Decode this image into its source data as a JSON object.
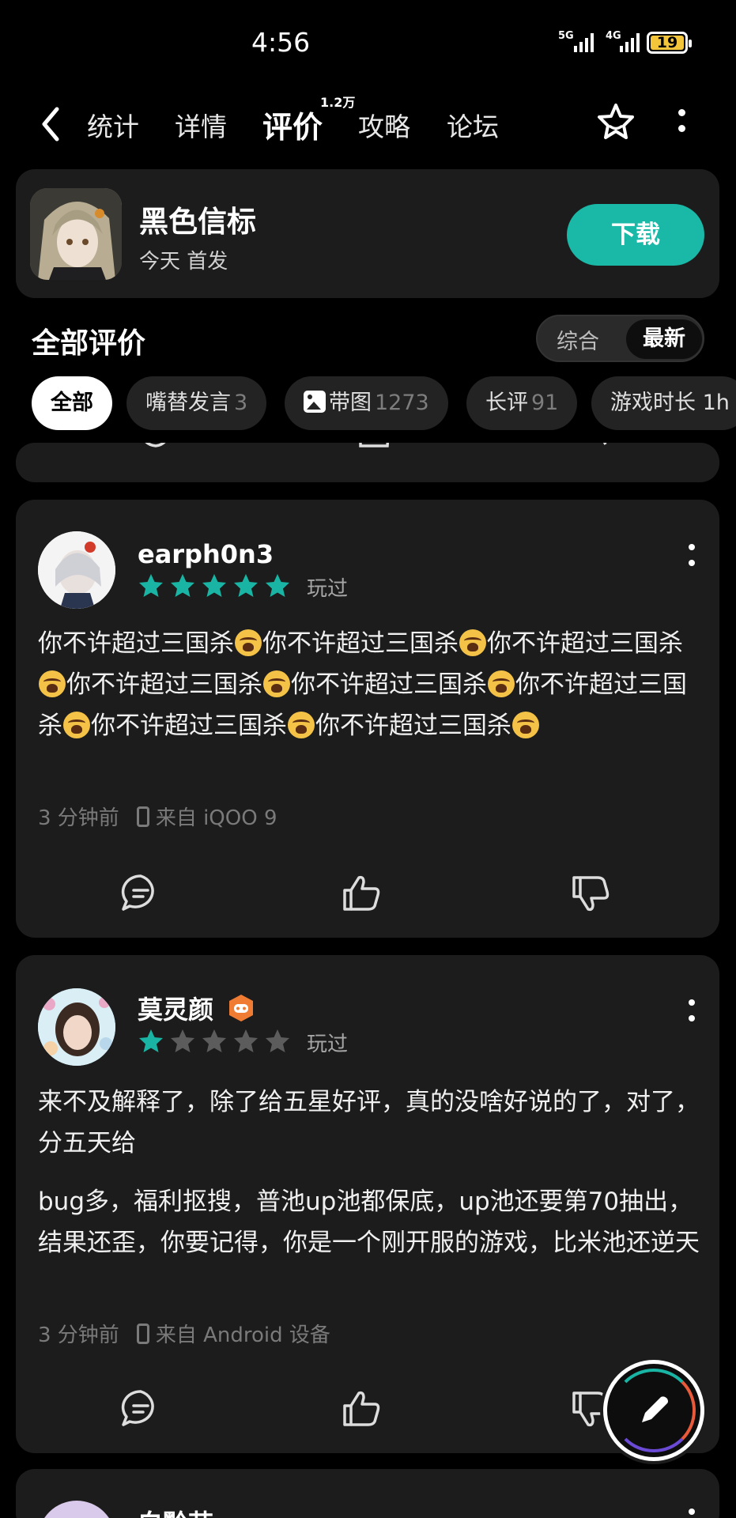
{
  "status_bar": {
    "time": "4:56",
    "signal1": "5G",
    "signal2": "4G",
    "battery": "19"
  },
  "nav": {
    "tabs": [
      {
        "label": "统计"
      },
      {
        "label": "详情"
      },
      {
        "label": "评价",
        "count": "1.2万",
        "active": true
      },
      {
        "label": "攻略"
      },
      {
        "label": "论坛"
      }
    ]
  },
  "game": {
    "title": "黑色信标",
    "subtitle": "今天 首发",
    "download_label": "下载"
  },
  "reviews_header": {
    "title": "全部评价",
    "sort_options": [
      "综合",
      "最新"
    ],
    "sort_selected": "最新"
  },
  "filters": [
    {
      "label": "全部",
      "count": ""
    },
    {
      "label": "嘴替发言",
      "count": "3"
    },
    {
      "label": "带图",
      "count": "1273"
    },
    {
      "label": "长评",
      "count": "91"
    },
    {
      "label": "游戏时长 1h",
      "count": ""
    }
  ],
  "reviews": [
    {
      "username": "earph0n3",
      "rating": 5,
      "status": "玩过",
      "text_segment": "你不许超过三国杀",
      "text_repeats": 8,
      "time": "3 分钟前",
      "device": "来自 iQOO 9"
    },
    {
      "username": "莫灵颜",
      "rating": 1,
      "status": "玩过",
      "paragraph1": "来不及解释了，除了给五星好评，真的没啥好说的了，对了，分五天给",
      "paragraph2": "bug多，福利抠搜，普池up池都保底，up池还要第70抽出，结果还歪，你要记得，你是一个刚开服的游戏，比米池还逆天",
      "time": "3 分钟前",
      "device": "来自 Android 设备"
    },
    {
      "username": "白黔苗"
    }
  ],
  "colors": {
    "accent": "#19b4a3",
    "card_bg": "#1c1c1c",
    "star_empty": "#5c5c5c"
  }
}
